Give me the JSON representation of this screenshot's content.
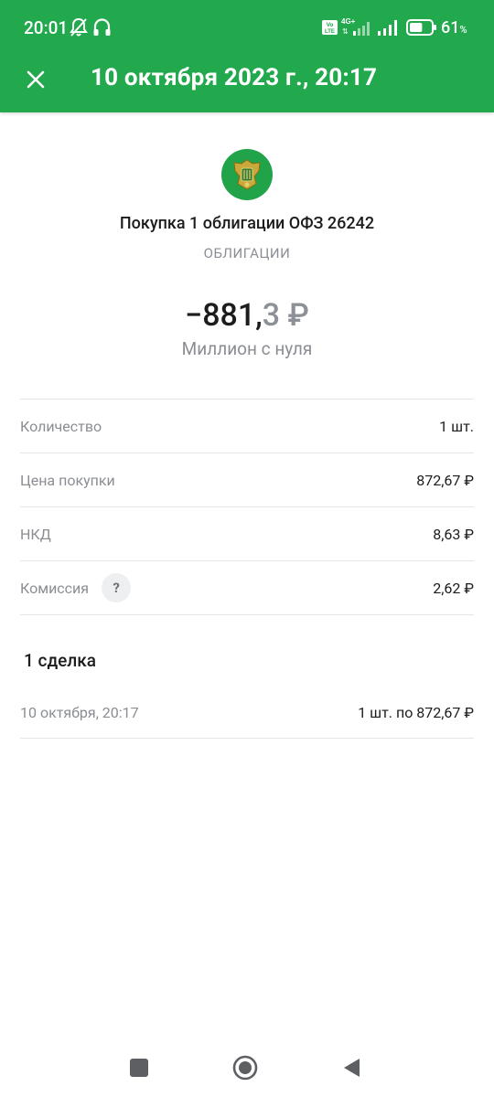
{
  "status_bar": {
    "time": "20:01",
    "battery_percent": "61",
    "battery_unit": "%",
    "battery_level": 0.61,
    "network": "4G+",
    "volte": "Vo LTE"
  },
  "header": {
    "title": "10 октября 2023 г., 20:17"
  },
  "operation": {
    "title": "Покупка 1 облигации ОФЗ 26242",
    "category": "ОБЛИГАЦИИ",
    "amount_main": "−881,",
    "amount_fraction": "3 ₽",
    "account": "Миллион с нуля"
  },
  "details": [
    {
      "label": "Количество",
      "value": "1 шт."
    },
    {
      "label": "Цена покупки",
      "value": "872,67 ₽"
    },
    {
      "label": "НКД",
      "value": "8,63 ₽"
    },
    {
      "label": "Комиссия",
      "value": "2,62 ₽",
      "help": "?"
    }
  ],
  "deals": {
    "heading": "1 сделка",
    "items": [
      {
        "date": "10 октября, 20:17",
        "info": "1 шт. по 872,67 ₽"
      }
    ]
  },
  "colors": {
    "brand_green": "#22a84d",
    "text_primary": "#1c1c1c",
    "text_secondary": "#8a8d93"
  }
}
